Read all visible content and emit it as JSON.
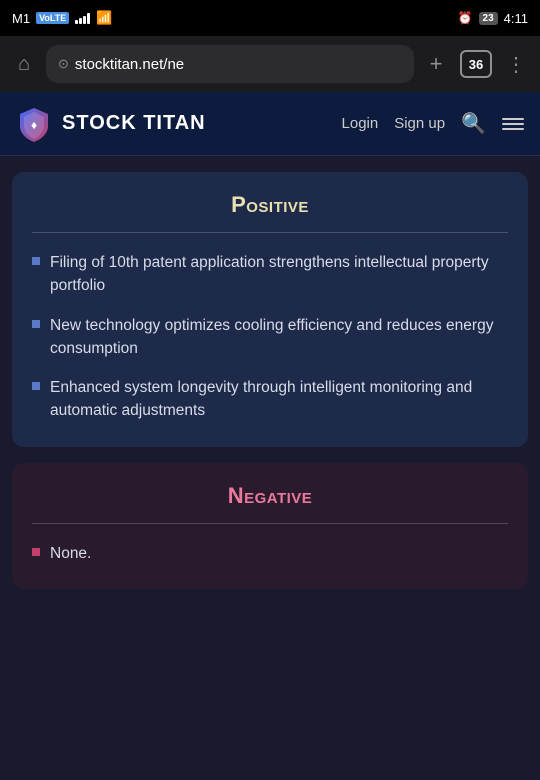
{
  "statusBar": {
    "carrier": "M1",
    "networkType": "VoLTE",
    "time": "4:11",
    "tabsCount": "36"
  },
  "browserChrome": {
    "urlText": "stocktitan.net/ne",
    "newTabLabel": "+",
    "moreLabel": "⋮"
  },
  "siteHeader": {
    "title": "STOCK TITAN",
    "loginLabel": "Login",
    "signupLabel": "Sign up"
  },
  "positiveSection": {
    "title": "Positive",
    "divider": true,
    "bullets": [
      "Filing of 10th patent application strengthens intellectual property portfolio",
      "New technology optimizes cooling efficiency and reduces energy consumption",
      "Enhanced system longevity through intelligent monitoring and automatic adjustments"
    ]
  },
  "negativeSection": {
    "title": "Negative",
    "divider": true,
    "bullets": [
      "None."
    ]
  }
}
